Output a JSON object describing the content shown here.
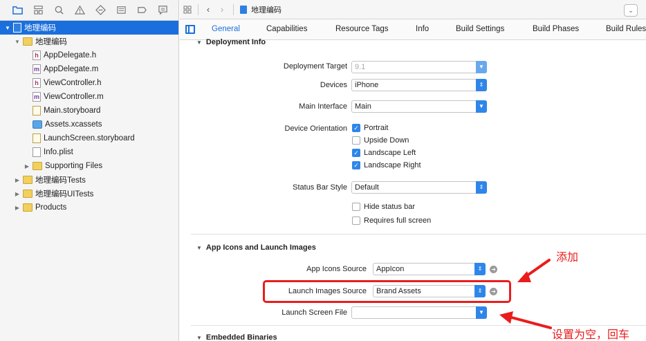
{
  "navigator": {
    "toolbar_icons": [
      "folder-icon",
      "hierarchy-icon",
      "search-icon",
      "warning-icon",
      "test-icon",
      "debug-icon",
      "breakpoint-icon",
      "report-icon"
    ],
    "items": [
      {
        "label": "地理编码",
        "kind": "project",
        "disclosure": "▼",
        "selected": true
      },
      {
        "label": "地理编码",
        "kind": "folder",
        "disclosure": "▼"
      },
      {
        "label": "AppDelegate.h",
        "kind": "header",
        "badge": "h"
      },
      {
        "label": "AppDelegate.m",
        "kind": "impl",
        "badge": "m"
      },
      {
        "label": "ViewController.h",
        "kind": "header",
        "badge": "h"
      },
      {
        "label": "ViewController.m",
        "kind": "impl",
        "badge": "m"
      },
      {
        "label": "Main.storyboard",
        "kind": "storyboard"
      },
      {
        "label": "Assets.xcassets",
        "kind": "assets"
      },
      {
        "label": "LaunchScreen.storyboard",
        "kind": "storyboard"
      },
      {
        "label": "Info.plist",
        "kind": "plist"
      },
      {
        "label": "Supporting Files",
        "kind": "folder",
        "disclosure": "▶"
      },
      {
        "label": "地理编码Tests",
        "kind": "folder",
        "disclosure": "▶"
      },
      {
        "label": "地理编码UITests",
        "kind": "folder",
        "disclosure": "▶"
      },
      {
        "label": "Products",
        "kind": "folder",
        "disclosure": "▶"
      }
    ]
  },
  "jumpbar": {
    "project": "地理编码"
  },
  "tabs": [
    "General",
    "Capabilities",
    "Resource Tags",
    "Info",
    "Build Settings",
    "Build Phases",
    "Build Rules"
  ],
  "active_tab": "General",
  "deployment": {
    "title": "Deployment Info",
    "target_label": "Deployment Target",
    "target_value": "9.1",
    "devices_label": "Devices",
    "devices_value": "iPhone",
    "main_interface_label": "Main Interface",
    "main_interface_value": "Main",
    "orientation_label": "Device Orientation",
    "orientations": [
      {
        "label": "Portrait",
        "checked": true
      },
      {
        "label": "Upside Down",
        "checked": false
      },
      {
        "label": "Landscape Left",
        "checked": true
      },
      {
        "label": "Landscape Right",
        "checked": true
      }
    ],
    "status_bar_label": "Status Bar Style",
    "status_bar_value": "Default",
    "hide_status_bar": "Hide status bar",
    "requires_full_screen": "Requires full screen"
  },
  "app_icons": {
    "title": "App Icons and Launch Images",
    "icons_source_label": "App Icons Source",
    "icons_source_value": "AppIcon",
    "launch_images_label": "Launch Images Source",
    "launch_images_value": "Brand Assets",
    "launch_screen_label": "Launch Screen File",
    "launch_screen_value": ""
  },
  "embedded": {
    "title": "Embedded Binaries"
  },
  "annotations": {
    "add": "添加",
    "clear": "设置为空，回车"
  },
  "colors": {
    "accent": "#1a6fdc",
    "annotation": "#ea1c1c"
  }
}
